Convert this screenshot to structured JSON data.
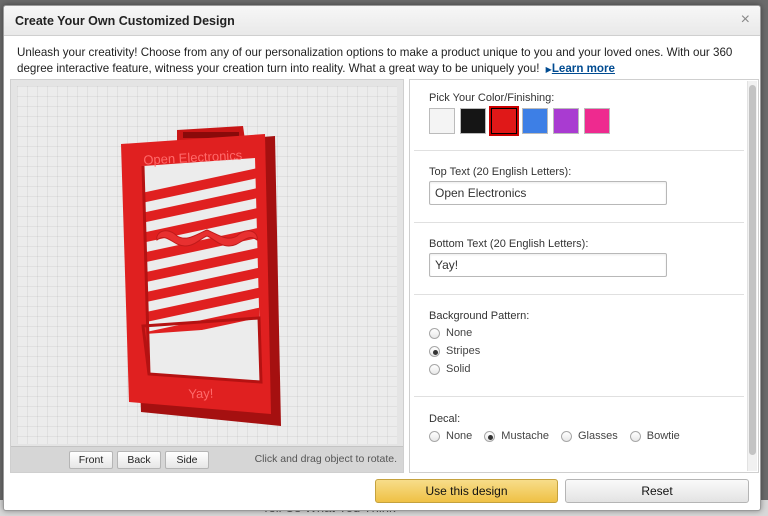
{
  "backdrop": {
    "text": "Tell Us What You Think"
  },
  "modal": {
    "title": "Create Your Own Customized Design",
    "close_glyph": "×"
  },
  "intro": {
    "text": "Unleash your creativity! Choose from any of our personalization options to make a product unique to you and your loved ones. With our 360 degree interactive feature, witness your creation turn into reality. What a great way to be uniquely you!",
    "learn_more": "Learn more"
  },
  "viewer": {
    "model_top_text": "Open Electronics",
    "model_bottom_text": "Yay!",
    "model_color": "#e02020",
    "buttons": {
      "front": "Front",
      "back": "Back",
      "side": "Side"
    },
    "hint": "Click and drag object to rotate."
  },
  "options": {
    "color": {
      "label": "Pick Your Color/Finishing:",
      "swatches": [
        {
          "name": "white",
          "hex": "#f4f4f4"
        },
        {
          "name": "black",
          "hex": "#151515"
        },
        {
          "name": "red",
          "hex": "#e01818",
          "selected": true
        },
        {
          "name": "blue",
          "hex": "#3d7fe6"
        },
        {
          "name": "purple",
          "hex": "#a93bd1"
        },
        {
          "name": "pink",
          "hex": "#ee2a8f"
        }
      ]
    },
    "top_text": {
      "label": "Top Text (20 English Letters):",
      "value": "Open Electronics"
    },
    "bottom_text": {
      "label": "Bottom Text (20 English Letters):",
      "value": "Yay!"
    },
    "pattern": {
      "label": "Background Pattern:",
      "choices": [
        "None",
        "Stripes",
        "Solid"
      ],
      "selected": "Stripes"
    },
    "decal": {
      "label": "Decal:",
      "choices": [
        "None",
        "Mustache",
        "Glasses",
        "Bowtie"
      ],
      "selected": "Mustache"
    }
  },
  "actions": {
    "use": "Use this design",
    "reset": "Reset"
  }
}
